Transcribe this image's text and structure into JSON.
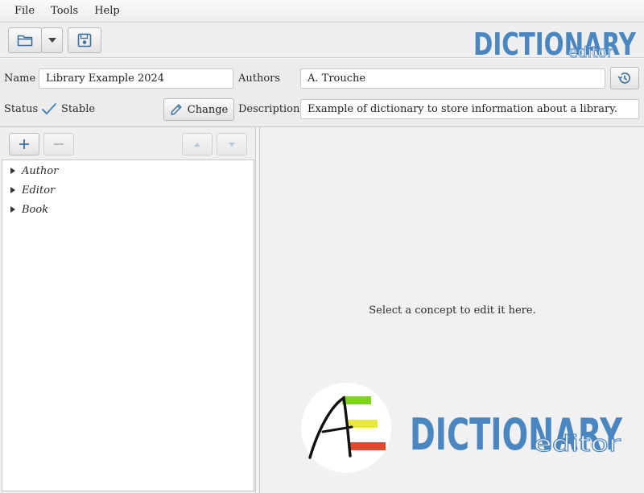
{
  "menubar": {
    "items": [
      "File",
      "Tools",
      "Help"
    ]
  },
  "toolbar": {
    "logo": {
      "word": "DICTIONARY",
      "sub": "editor",
      "color": "#4a86c0"
    }
  },
  "properties": {
    "name_label": "Name",
    "name_value": "Library Example 2024",
    "authors_label": "Authors",
    "authors_value": "A. Trouche",
    "status_label": "Status",
    "status_value": "Stable",
    "change_label": "Change",
    "description_label": "Description",
    "description_value": "Example of dictionary to store information about a library."
  },
  "tree": {
    "items": [
      "Author",
      "Editor",
      "Book"
    ]
  },
  "editor": {
    "placeholder": "Select a concept to edit it here.",
    "logo": {
      "word": "DICTIONARY",
      "sub": "editor",
      "color": "#4a86c0"
    }
  },
  "colors": {
    "accent": "#4a86c0",
    "bar_green": "#7ed321",
    "bar_yellow": "#e8e83a",
    "bar_red": "#e04a2e"
  }
}
